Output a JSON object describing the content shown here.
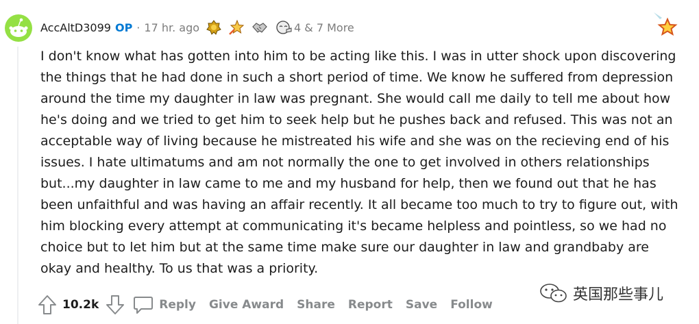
{
  "comment": {
    "author": "AccAltD3099",
    "op_badge": "OP",
    "separator": "·",
    "timestamp": "17 hr. ago",
    "awards": [
      {
        "icon": "gold-medal-icon"
      },
      {
        "icon": "rocket-star-icon"
      },
      {
        "icon": "handshake-icon"
      },
      {
        "icon": "facepalm-face-icon"
      }
    ],
    "award_count_text": "4 & 7 More",
    "body_lines": [
      "I don't know what has gotten into him to be acting like this. I was in utter shock upon discovering",
      "the things that he had done in such a short period of time. We know he suffered from depression",
      "around the time my daughter in law was pregnant. She would call me daily to tell me about how",
      "he's doing and we tried to get him to seek help but he pushes back and refused. This was not an",
      "acceptable way of living because he mistreated his wife and she was on the recieving end of his",
      "issues. I hate ultimatums and am not normally the one to get involved in others relationships",
      "but...my daughter in law came to me and my husband for help, then we found out that he has",
      "been unfaithful and was having an affair recently. It all became too much to try to figure out, with",
      "him blocking every attempt at communicating it's became helpless and pointless, so we had no",
      "choice but to let him but at the same time make sure our daughter in law and grandbaby are",
      "okay and healthy. To us that was a priority."
    ],
    "score": "10.2k",
    "actions": {
      "reply": "Reply",
      "give_award": "Give Award",
      "share": "Share",
      "report": "Report",
      "save": "Save",
      "follow": "Follow"
    }
  },
  "watermark": {
    "text": "英国那些事儿",
    "icon": "wechat-icon"
  },
  "colors": {
    "op_blue": "#0079d3",
    "meta_gray": "#7c7c7c",
    "action_gray": "#878a8c",
    "text": "#1c1c1c",
    "avatar_green": "#94e044"
  }
}
